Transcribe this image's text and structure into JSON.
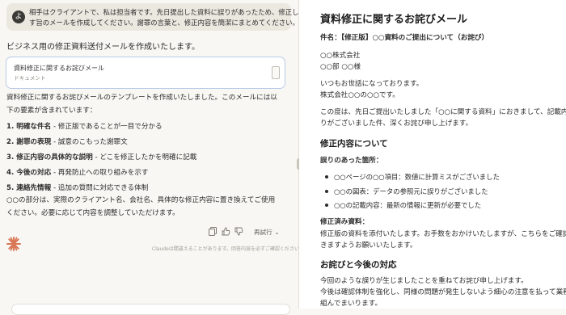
{
  "chat": {
    "user_initial": "よ",
    "user_message_lines": [
      "相手はクライアントで、私は担当者です。先日提出した資料に誤りがあったため、修正したものを送り直",
      "す旨のメールを作成してください。謝罪の言葉と、修正内容を簡潔にまとめてください。"
    ],
    "intro": "ビジネス用の修正資料送付メールを作成いたします。",
    "artifact": {
      "title": "資料修正に関するお詫びメール",
      "subtitle": "ドキュメント"
    },
    "description_lines": [
      "資料修正に関するお詫びメールのテンプレートを作成いたしました。このメールには以",
      "下の要素が含まれています："
    ],
    "points": [
      {
        "label": "1. 明確な件名",
        "text": " - 修正版であることが一目で分かる"
      },
      {
        "label": "2. 謝罪の表現",
        "text": " - 誠意のこもった謝罪文"
      },
      {
        "label": "3. 修正内容の具体的な説明",
        "text": " - どこを修正したかを明確に記載"
      },
      {
        "label": "4. 今後の対応",
        "text": " - 再発防止への取り組みを示す"
      },
      {
        "label": "5. 連絡先情報",
        "text": " - 追加の質問に対応できる体制"
      }
    ],
    "note_lines": [
      "○○の部分は、実際のクライアント名、会社名、具体的な修正内容に置き換えてご使用",
      "ください。必要に応じて内容を調整していただけます。"
    ],
    "retry_label": "再試行",
    "disclaimer": "Claudeは間違えることがあります。回答内容を必ずご確認ください。"
  },
  "document": {
    "title": "資料修正に関するお詫びメール",
    "subject": "件名：【修正版】○○資料のご提出について（お詫び）",
    "company": "○○株式会社",
    "recipient": "○○部 ○○様",
    "greeting": "いつもお世話になっております。",
    "sender": "株式会社○○の○○です。",
    "body1_line1": "この度は、先日ご提出いたしました「○○に関する資料」におきまして、記載内容",
    "body1_line2": "りがございました件、深くお詫び申し上げます。",
    "section1": "修正内容について",
    "errors_label": "誤りのあった箇所：",
    "errors": [
      "○○ページの○○項目：数値に計算ミスがございました",
      "○○の図表：データの参照元に誤りがございました",
      "○○の記載内容：最新の情報に更新が必要でした"
    ],
    "fixed_label": "修正済み資料：",
    "fixed_line1": "修正版の資料を添付いたします。お手数をおかけいたしますが、こちらをご確認い",
    "fixed_line2": "きますようお願いいたします。",
    "section2": "お詫びと今後の対応",
    "closing_line1": "今回のような誤りが生じましたことを重ねてお詫び申し上げます。",
    "closing_line2": "今後は確認体制を強化し、同様の問題が発生しないよう細心の注意を払って業務に",
    "closing_line3": "組んでまいります。"
  },
  "colors": {
    "accent_orange": "#d97757",
    "artifact_border": "#b9cbe8"
  }
}
